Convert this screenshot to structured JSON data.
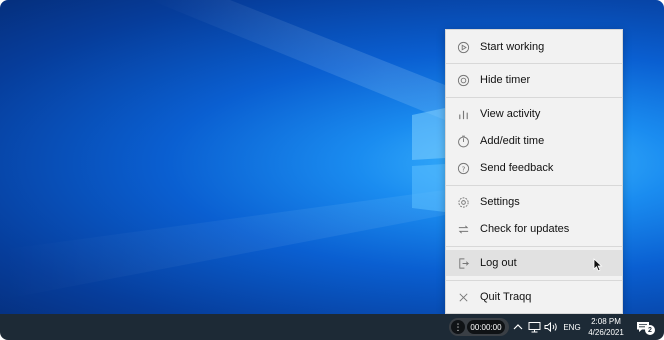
{
  "menu": {
    "items": [
      {
        "label": "Start working",
        "icon": "play-circle-icon"
      },
      {
        "label": "Hide timer",
        "icon": "hide-timer-icon"
      },
      {
        "label": "View activity",
        "icon": "bar-chart-icon"
      },
      {
        "label": "Add/edit time",
        "icon": "clock-icon"
      },
      {
        "label": "Send feedback",
        "icon": "question-circle-icon"
      },
      {
        "label": "Settings",
        "icon": "gear-icon"
      },
      {
        "label": "Check for updates",
        "icon": "refresh-arrows-icon"
      },
      {
        "label": "Log out",
        "icon": "logout-icon"
      },
      {
        "label": "Quit Traqq",
        "icon": "close-icon"
      }
    ]
  },
  "taskbar": {
    "timer": "00:00:00",
    "menu_dots": "⋮",
    "language": "ENG",
    "time": "2:08 PM",
    "date": "4/26/2021",
    "notification_count": "2"
  }
}
